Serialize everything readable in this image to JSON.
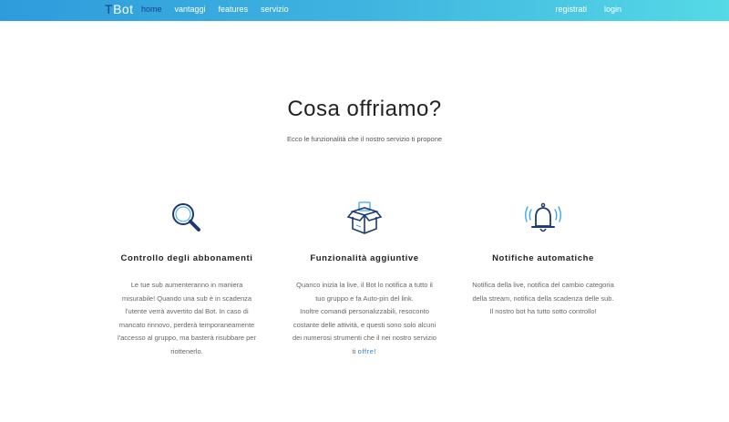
{
  "nav": {
    "brand_t": "T",
    "brand_rest": "Bot",
    "left": [
      "home",
      "vantaggi",
      "features",
      "servizio"
    ],
    "right": [
      "registrati",
      "login"
    ]
  },
  "hero": {
    "title": "Cosa offriamo?",
    "subtitle": "Ecco le funzionalità che il nostro servizio ti propone"
  },
  "features": [
    {
      "icon": "search-icon",
      "title": "Controllo degli abbonamenti",
      "description": "Le tue sub aumenteranno in maniera misurabile! Quando una sub è in scadenza l'utente verrà avvertito dal Bot. In caso di mancato rinnovo, perderà temporaneamente l'accesso al gruppo, ma basterà risubbare per riottenerlo."
    },
    {
      "icon": "open-box-icon",
      "title": "Funzionalità aggiuntive",
      "description_1": "Quanco inizia la live, il Bot lo notifica a tutto il tuo gruppo e fa Auto-pin del link.",
      "description_2": "Inoltre comandi personalizzabili, resoconto costante delle attività, e questi sono solo alcuni dei numerosi strumenti che il nei nostro servizio ti ",
      "link": "offre!"
    },
    {
      "icon": "bell-icon",
      "title": "Notifiche automatiche",
      "description": "Notifica della live, notifica del cambio categoria della stream, notifica della scadenza delle sub. Il nostro bot ha tutto sotto controllo!"
    }
  ],
  "colors": {
    "nav_gradient_start": "#2e9bdb",
    "nav_gradient_end": "#55d9e6",
    "icon_stroke": "#1d3a6e",
    "icon_accent": "#3fa9e8",
    "link": "#2c7fd4"
  }
}
